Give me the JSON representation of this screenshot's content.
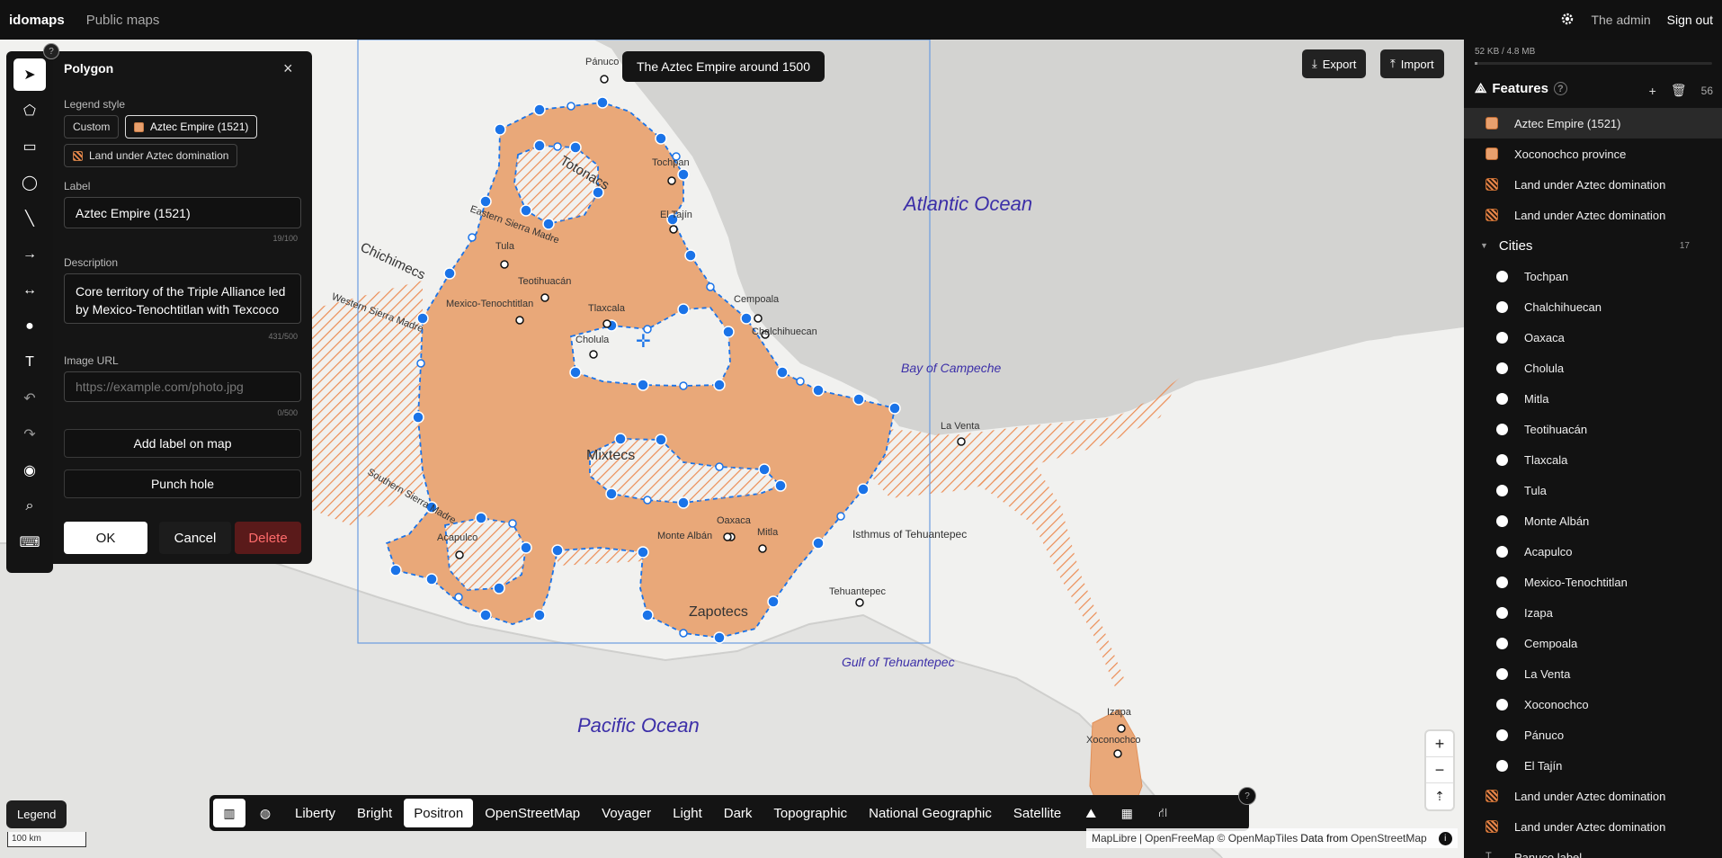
{
  "header": {
    "brand": "idomaps",
    "nav_public": "Public maps",
    "user": "The admin",
    "signout": "Sign out"
  },
  "map": {
    "title": "The Aztec Empire around 1500",
    "export_label": "Export",
    "import_label": "Import",
    "oceans": [
      "Atlantic Ocean",
      "Bay of Campeche",
      "Pacific Ocean",
      "Gulf of Tehuantepec"
    ],
    "isthmus": "Isthmus of Tehuantepec",
    "regions": [
      "Chichimecs",
      "Totonacs",
      "Mixtecs",
      "Zapotecs"
    ],
    "ranges": [
      "Eastern Sierra Madre",
      "Western Sierra Madre",
      "Southern Sierra Madre"
    ],
    "cities": [
      "Pánuco",
      "Tochpan",
      "El Tajín",
      "Tula",
      "Teotihuacán",
      "Mexico-Tenochtitlan",
      "Tlaxcala",
      "Cholula",
      "Cempoala",
      "Chalchihuecan",
      "La Venta",
      "Oaxaca",
      "Monte Albán",
      "Mitla",
      "Acapulco",
      "Tehuantepec",
      "Izapa",
      "Xoconochco"
    ],
    "scale_label": "100 km",
    "attribution": {
      "parts": [
        "MapLibre",
        "|",
        "OpenFreeMap",
        "© OpenMapTiles",
        "Data from",
        "OpenStreetMap"
      ]
    },
    "legend_label": "Legend",
    "colors": {
      "empire_fill": "#e9a879",
      "vertex": "#1a73e8",
      "land": "#f1f1ef",
      "water": "#d6d6d4"
    }
  },
  "toolrail": {
    "tools": [
      "select-tool",
      "polygon-tool",
      "rectangle-tool",
      "circle-tool",
      "line-tool",
      "arrow-tool",
      "double-arrow-tool",
      "point-tool",
      "text-tool",
      "undo-tool",
      "redo-tool",
      "globe-tool",
      "search-tool",
      "keyboard-tool"
    ]
  },
  "panel": {
    "title": "Polygon",
    "legend_style_label": "Legend style",
    "style_custom": "Custom",
    "style_selected": "Aztec Empire (1521)",
    "style_other": "Land under Aztec domination",
    "label_label": "Label",
    "label_value": "Aztec Empire (1521)",
    "label_counter": "19/100",
    "description_label": "Description",
    "description_value": "Core territory of the Triple Alliance led by Mexico-Tenochtitlan with Texcoco and Tlacopan, dominating",
    "description_counter": "431/500",
    "image_url_label": "Image URL",
    "image_url_placeholder": "https://example.com/photo.jpg",
    "image_url_counter": "0/500",
    "add_label_btn": "Add label on map",
    "punch_hole_btn": "Punch hole",
    "ok_btn": "OK",
    "cancel_btn": "Cancel",
    "delete_btn": "Delete"
  },
  "sidebar": {
    "storage": "52 KB / 4.8 MB",
    "storage_fraction": 0.011,
    "features_title": "Features",
    "features_count": "56",
    "top_items": [
      {
        "label": "Aztec Empire (1521)",
        "kind": "poly",
        "selected": true
      },
      {
        "label": "Xoconochco province",
        "kind": "poly"
      },
      {
        "label": "Land under Aztec domination",
        "kind": "hatch"
      },
      {
        "label": "Land under Aztec domination",
        "kind": "hatch"
      }
    ],
    "group_title": "Cities",
    "group_count": "17",
    "cities": [
      "Tochpan",
      "Chalchihuecan",
      "Oaxaca",
      "Cholula",
      "Mitla",
      "Teotihuacán",
      "Tlaxcala",
      "Tula",
      "Monte Albán",
      "Acapulco",
      "Mexico-Tenochtitlan",
      "Izapa",
      "Cempoala",
      "La Venta",
      "Xoconochco",
      "Pánuco",
      "El Tajín"
    ],
    "bottom_items": [
      {
        "label": "Land under Aztec domination",
        "kind": "hatch"
      },
      {
        "label": "Land under Aztec domination",
        "kind": "hatch"
      },
      {
        "label": "Panuco label",
        "kind": "lbl"
      }
    ]
  },
  "stylebar": {
    "styles": [
      "Liberty",
      "Bright",
      "Positron",
      "OpenStreetMap",
      "Voyager",
      "Light",
      "Dark",
      "Topographic",
      "National Geographic",
      "Satellite"
    ],
    "active": "Positron"
  }
}
